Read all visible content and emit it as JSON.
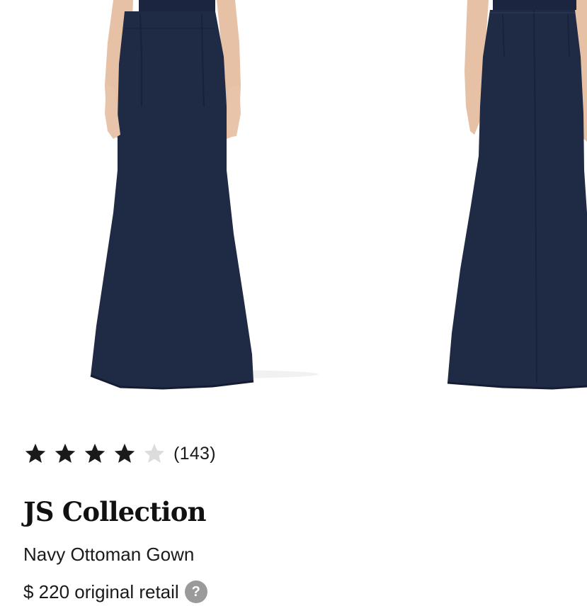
{
  "product": {
    "images": [
      {
        "name": "front-view"
      },
      {
        "name": "back-view"
      }
    ],
    "rating": {
      "stars_filled": 4,
      "stars_total": 5,
      "count_text": "(143)"
    },
    "brand": "JS Collection",
    "name": "Navy Ottoman Gown",
    "price_text": "$ 220 original retail",
    "info_icon": "?"
  },
  "colors": {
    "dress_navy": "#1f2a44",
    "skin": "#e8c4aa",
    "star_filled": "#1a1a1a",
    "star_empty": "#dcdcdc",
    "info_badge": "#9a9a9a"
  },
  "icons": [
    "star-icon",
    "info-icon"
  ]
}
